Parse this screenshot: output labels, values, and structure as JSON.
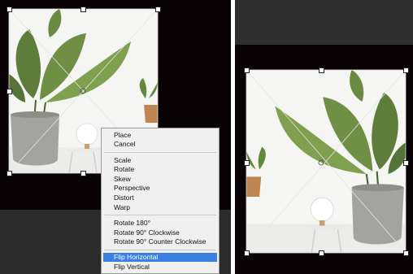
{
  "left_view": {
    "canvas_bg": "#0a0306",
    "workspace_bg": "#2b2b2b"
  },
  "right_view": {
    "canvas_bg": "#0a0306",
    "workspace_bg": "#2f2f2f"
  },
  "context_menu": {
    "group1": [
      "Place",
      "Cancel"
    ],
    "group2": [
      "Scale",
      "Rotate",
      "Skew",
      "Perspective",
      "Distort",
      "Warp"
    ],
    "group3": [
      "Rotate 180°",
      "Rotate 90° Clockwise",
      "Rotate 90° Counter Clockwise"
    ],
    "group4": [
      "Flip Horizontal",
      "Flip Vertical"
    ],
    "selected_item": "Flip Horizontal",
    "highlight_color": "#3b80e0"
  }
}
